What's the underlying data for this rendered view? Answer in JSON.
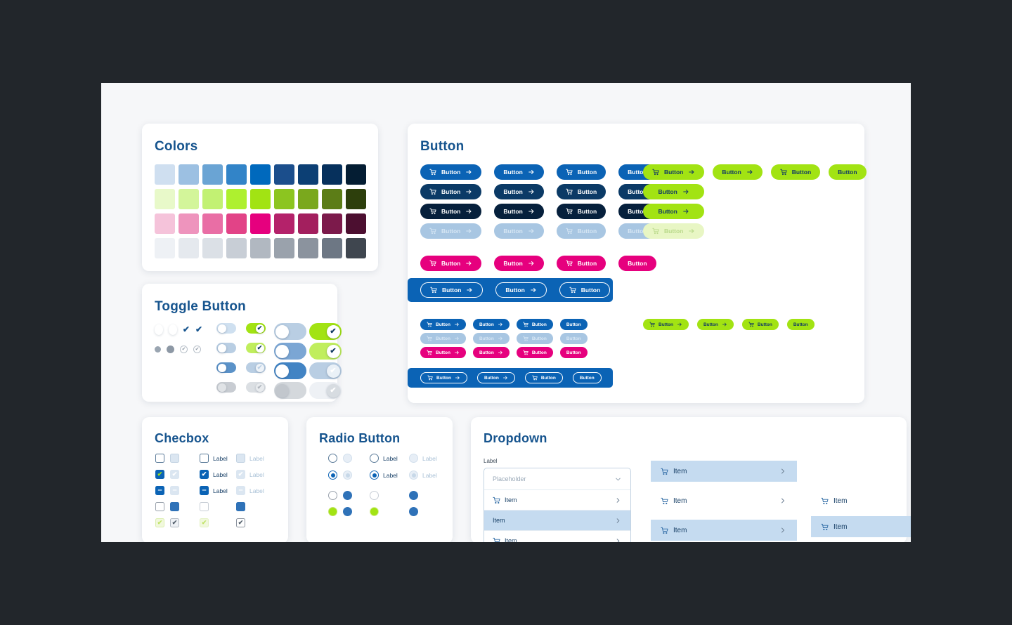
{
  "theme": {
    "page_bg": "#22262b",
    "canvas_bg": "#f6f7f9",
    "card_bg": "#ffffff",
    "title_color": "#16548e",
    "brand_blue": "#0b63b5",
    "brand_navy": "#0b3a66",
    "brand_dark": "#06203c",
    "brand_light_blue": "#a8c6e2",
    "brand_magenta": "#e6007e",
    "brand_green": "#a2e313",
    "banner_blue": "#0b63b5",
    "menu_selected": "#c5dbf0"
  },
  "cards": {
    "colors": {
      "title": "Colors",
      "rows": [
        {
          "name": "blue",
          "swatches": [
            "#cfdff0",
            "#9cc0e2",
            "#6aa4d4",
            "#3284c8",
            "#0069bd",
            "#1b4e8c",
            "#0c3f74",
            "#06305c",
            "#041d33"
          ]
        },
        {
          "name": "green",
          "swatches": [
            "#e8f9c9",
            "#d3f59a",
            "#c2f173",
            "#aef02f",
            "#a2e313",
            "#8cc520",
            "#7aa81d",
            "#5c7d17",
            "#2d3f0c"
          ]
        },
        {
          "name": "pink",
          "swatches": [
            "#f5c3da",
            "#ee94bd",
            "#e96ea5",
            "#e24387",
            "#e6007e",
            "#b4226a",
            "#a31f5e",
            "#7c1a4b",
            "#4c0f30"
          ]
        },
        {
          "name": "grey",
          "swatches": [
            "#eef1f5",
            "#e5e9ee",
            "#dbe0e6",
            "#c8ced6",
            "#b1b8c1",
            "#9aa2ac",
            "#8b939e",
            "#6d7784",
            "#3f464f"
          ]
        }
      ]
    },
    "toggle": {
      "title": "Toggle Button",
      "ghost": {
        "row1": [
          "knob",
          "knob",
          "check",
          "check"
        ],
        "row2": [
          "dot",
          "dot-lg",
          "circle",
          "circle"
        ]
      },
      "columns": [
        {
          "size": "sm",
          "items": [
            {
              "on": false,
              "track": "#cfe0f0",
              "knob": "#ffffff",
              "tick": "",
              "opacity": 1
            },
            {
              "on": false,
              "track": "#b9cee3",
              "knob": "#ffffff",
              "tick": "",
              "opacity": 1
            },
            {
              "on": false,
              "track": "#5b92c8",
              "knob": "#ffffff",
              "tick": "",
              "opacity": 1
            },
            {
              "on": false,
              "track": "#b6bcc3",
              "knob": "#d6dade",
              "tick": "",
              "opacity": 0.75
            }
          ]
        },
        {
          "size": "sm",
          "items": [
            {
              "on": true,
              "track": "#a2e313",
              "knob": "#ffffff",
              "tick": "✔",
              "tick_color": "#123a63",
              "opacity": 1
            },
            {
              "on": true,
              "track": "#c0ee5d",
              "knob": "#ffffff",
              "tick": "✔",
              "tick_color": "#123a63",
              "opacity": 1
            },
            {
              "on": true,
              "track": "#b9cee3",
              "knob": "#eef3f8",
              "tick": "✔",
              "tick_color": "#b9cee3",
              "opacity": 1
            },
            {
              "on": true,
              "track": "#d3d8dd",
              "knob": "#e3e7ea",
              "tick": "✔",
              "tick_color": "#9aa2ac",
              "opacity": 0.8
            }
          ]
        },
        {
          "size": "lg",
          "items": [
            {
              "on": false,
              "track": "#b9cee3",
              "knob": "#ffffff",
              "tick": "",
              "opacity": 1
            },
            {
              "on": false,
              "track": "#7ba6d4",
              "knob": "#ffffff",
              "tick": "",
              "opacity": 1
            },
            {
              "on": false,
              "track": "#4284c4",
              "knob": "#ffffff",
              "tick": "",
              "opacity": 1
            },
            {
              "on": false,
              "track": "#cdd2d7",
              "knob": "#b8bec5",
              "tick": "",
              "opacity": 0.85
            }
          ]
        },
        {
          "size": "lg",
          "items": [
            {
              "on": true,
              "track": "#a2e313",
              "knob": "#ffffff",
              "tick": "✔",
              "tick_color": "#123a63",
              "opacity": 1
            },
            {
              "on": true,
              "track": "#c0ee5d",
              "knob": "#ffffff",
              "tick": "✔",
              "tick_color": "#123a63",
              "opacity": 1
            },
            {
              "on": true,
              "track": "#b9cee3",
              "knob": "#eaf1f7",
              "tick": "✔",
              "tick_color": "#ffffff",
              "opacity": 1
            },
            {
              "on": true,
              "track": "#eef1f5",
              "knob": "#d7dce1",
              "tick": "✔",
              "tick_color": "#ffffff",
              "opacity": 1
            }
          ]
        }
      ]
    },
    "button": {
      "title": "Button",
      "label": "Button",
      "icons": {
        "cart": "cart-icon",
        "arrow": "arrow-right-icon"
      },
      "blue_grid": {
        "rows": [
          {
            "bg": "#0b63b5",
            "fg": "#ffffff"
          },
          {
            "bg": "#0b3a66",
            "fg": "#ffffff"
          },
          {
            "bg": "#06203c",
            "fg": "#ffffff"
          },
          {
            "bg": "#a8c6e2",
            "fg": "#d6e6f4"
          }
        ],
        "variants": [
          "cart-label-arrow",
          "label-arrow",
          "cart-label",
          "label"
        ]
      },
      "magenta_row": {
        "bg": "#e6007e",
        "fg": "#ffffff"
      },
      "green_grid": {
        "rows": [
          {
            "bg": "#a2e313",
            "fg": "#123a63",
            "variants": [
              "cart-label-arrow",
              "label-arrow",
              "cart-label",
              "label"
            ]
          },
          {
            "bg": "#a2e313",
            "fg": "#123a63",
            "variants": [
              "label-arrow"
            ]
          },
          {
            "bg": "#a2e313",
            "fg": "#123a63",
            "variants": [
              "label-arrow"
            ]
          },
          {
            "bg": "#e8f6c4",
            "fg": "#b9d98a",
            "variants": [
              "cart-label-arrow"
            ]
          }
        ]
      },
      "banner_top": {
        "bg": "#0b63b5",
        "fg": "#ffffff",
        "border": "#ffffff"
      },
      "small_grid": {
        "rows": [
          {
            "bg": "#0b63b5",
            "fg": "#ffffff"
          },
          {
            "bg": "#a8c6e2",
            "fg": "#d6e6f4"
          },
          {
            "bg": "#e6007e",
            "fg": "#ffffff"
          }
        ]
      },
      "small_green_row": {
        "bg": "#a2e313",
        "fg": "#123a63"
      },
      "banner_bottom": {
        "bg": "#0b63b5",
        "fg": "#ffffff",
        "border": "#ffffff"
      }
    },
    "checkbox": {
      "title": "Checbox",
      "label": "Label",
      "marks": {
        "check": "✔",
        "indeterminate": "–"
      },
      "rows": [
        [
          {
            "state": "empty",
            "bg": "#ffffff",
            "border": "#5b7b99",
            "fg": ""
          },
          {
            "state": "empty",
            "bg": "#dbe6f1",
            "border": "#c3d3e2",
            "fg": ""
          },
          {
            "state": "empty-label",
            "bg": "#ffffff",
            "border": "#5b7b99",
            "fg": "",
            "label_color": "#173f66"
          },
          {
            "state": "empty-label",
            "bg": "#dbe6f1",
            "border": "#c3d3e2",
            "fg": "",
            "label_color": "#a8c0d6"
          }
        ],
        [
          {
            "state": "checked",
            "bg": "#0b63b5",
            "border": "#0b63b5",
            "fg": "#a2e313"
          },
          {
            "state": "checked",
            "bg": "#dbe6f1",
            "border": "#dbe6f1",
            "fg": "#ffffff"
          },
          {
            "state": "checked-label",
            "bg": "#0b63b5",
            "border": "#0b63b5",
            "fg": "#ffffff",
            "label_color": "#173f66"
          },
          {
            "state": "checked-label",
            "bg": "#dbe6f1",
            "border": "#dbe6f1",
            "fg": "#ffffff",
            "label_color": "#a8c0d6"
          }
        ],
        [
          {
            "state": "indeterminate",
            "bg": "#0b63b5",
            "border": "#0b63b5",
            "fg": "#ffffff"
          },
          {
            "state": "indeterminate",
            "bg": "#dbe6f1",
            "border": "#dbe6f1",
            "fg": "#ffffff"
          },
          {
            "state": "indeterminate-label",
            "bg": "#0b63b5",
            "border": "#0b63b5",
            "fg": "#ffffff",
            "label_color": "#173f66"
          },
          {
            "state": "indeterminate-label",
            "bg": "#dbe6f1",
            "border": "#dbe6f1",
            "fg": "#ffffff",
            "label_color": "#a8c0d6"
          }
        ],
        [
          {
            "state": "empty",
            "bg": "#ffffff",
            "border": "#9aa2ac",
            "fg": ""
          },
          {
            "state": "filled",
            "bg": "#2f72b8",
            "border": "#2f72b8",
            "fg": ""
          },
          {
            "state": "empty",
            "bg": "#ffffff",
            "border": "#c8ced6",
            "fg": ""
          },
          {
            "state": "filled",
            "bg": "#2f72b8",
            "border": "#2f72b8",
            "fg": ""
          }
        ],
        [
          {
            "state": "checked",
            "bg": "#f1f8dd",
            "border": "#dbeeae",
            "fg": "#c2e36a"
          },
          {
            "state": "checked",
            "bg": "#eef1f5",
            "border": "#b1b8c1",
            "fg": "#54606c"
          },
          {
            "state": "checked",
            "bg": "#f1f8dd",
            "border": "#e4f2c4",
            "fg": "#c2e36a"
          },
          {
            "state": "checked",
            "bg": "#ffffff",
            "border": "#8b939e",
            "fg": "#54606c"
          }
        ]
      ]
    },
    "radio": {
      "title": "Radio Button",
      "label": "Label",
      "rows": [
        [
          {
            "state": "empty",
            "bg": "#ffffff",
            "border": "#5b7b99",
            "dot": ""
          },
          {
            "state": "empty",
            "bg": "#e7eef6",
            "border": "#d2dfec",
            "dot": ""
          },
          {
            "state": "empty-label",
            "bg": "#ffffff",
            "border": "#5b7b99",
            "dot": "",
            "label_color": "#173f66"
          },
          {
            "state": "empty-label",
            "bg": "#e7eef6",
            "border": "#d2dfec",
            "dot": "",
            "label_color": "#a8c0d6"
          }
        ],
        [
          {
            "state": "selected",
            "bg": "#ffffff",
            "border": "#0b63b5",
            "dot": "#0b63b5"
          },
          {
            "state": "selected",
            "bg": "#e7eef6",
            "border": "#d2dfec",
            "dot": "#c7d8e8"
          },
          {
            "state": "selected-label",
            "bg": "#ffffff",
            "border": "#0b63b5",
            "dot": "#0b63b5",
            "label_color": "#173f66"
          },
          {
            "state": "selected-label",
            "bg": "#e7eef6",
            "border": "#d2dfec",
            "dot": "#c7d8e8",
            "label_color": "#a8c0d6"
          }
        ],
        [
          {
            "state": "empty",
            "bg": "#ffffff",
            "border": "#9aa2ac",
            "dot": ""
          },
          {
            "state": "filled",
            "bg": "#2f72b8",
            "border": "#2f72b8",
            "dot": ""
          },
          {
            "state": "empty",
            "bg": "#ffffff",
            "border": "#c8ced6",
            "dot": ""
          },
          {
            "state": "filled",
            "bg": "#2f72b8",
            "border": "#2f72b8",
            "dot": ""
          }
        ],
        [
          {
            "state": "selected",
            "bg": "#a2e313",
            "border": "#c2e36a",
            "dot": ""
          },
          {
            "state": "filled",
            "bg": "#2f72b8",
            "border": "#2f72b8",
            "dot": ""
          },
          {
            "state": "selected",
            "bg": "#a2e313",
            "border": "#d8ef9c",
            "dot": ""
          },
          {
            "state": "filled",
            "bg": "#2f72b8",
            "border": "#2f72b8",
            "dot": ""
          }
        ]
      ]
    },
    "dropdown": {
      "title": "Dropdown",
      "field_label": "Label",
      "placeholder": "Placeholder",
      "chevron_down": "chevron-down-icon",
      "chevron_right": "chevron-right-icon",
      "list": [
        {
          "text": "Item",
          "icon": true,
          "selected": false
        },
        {
          "text": "Item",
          "icon": false,
          "selected": true
        },
        {
          "text": "Item",
          "icon": true,
          "selected": false
        }
      ],
      "menu_mid": [
        {
          "text": "Item",
          "icon": true,
          "selected": true
        },
        {
          "text": "Item",
          "icon": true,
          "selected": false
        },
        {
          "text": "Item",
          "icon": true,
          "selected": true
        }
      ],
      "menu_right": [
        {
          "text": "Item",
          "icon": true,
          "selected": false
        },
        {
          "text": "Item",
          "icon": true,
          "selected": true
        }
      ]
    }
  }
}
